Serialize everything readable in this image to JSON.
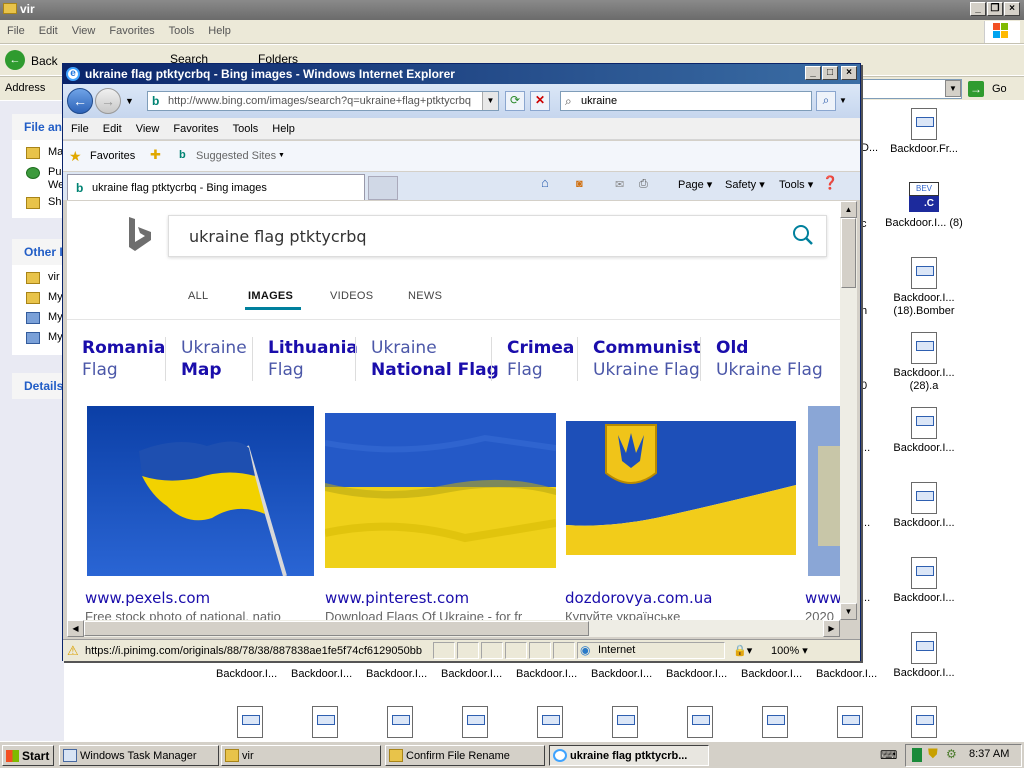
{
  "explorer": {
    "title": "vir",
    "menu": [
      "File",
      "Edit",
      "View",
      "Favorites",
      "Tools",
      "Help"
    ],
    "toolbar": {
      "back": "Back",
      "search": "Search",
      "folders": "Folders"
    },
    "address_label": "Address",
    "go_label": "Go",
    "left_pane": {
      "file_tasks": "File an",
      "file_items": [
        "Ma",
        "Pul",
        "We",
        "Sha"
      ],
      "other_places": "Other I",
      "other_items": [
        "vir",
        "My",
        "My",
        "My"
      ],
      "details": "Details"
    },
    "clipped_col": [
      "D...",
      "c",
      "h",
      "0",
      "...",
      "...",
      "...",
      "...",
      "..."
    ],
    "files_right": [
      {
        "name": "Backdoor.Fr...",
        "icon": "doc"
      },
      {
        "name": "Backdoor.I... (8)",
        "icon": "c-source"
      },
      {
        "name": "Backdoor.I... (18).Bomber",
        "icon": "doc"
      },
      {
        "name": "Backdoor.I... (28).a",
        "icon": "doc"
      },
      {
        "name": "Backdoor.I...",
        "icon": "doc"
      },
      {
        "name": "Backdoor.I...",
        "icon": "doc"
      },
      {
        "name": "Backdoor.I...",
        "icon": "doc"
      },
      {
        "name": "Backdoor.I...",
        "icon": "doc"
      },
      {
        "name": "Backdoor.I...",
        "icon": "doc"
      }
    ],
    "files_bottom": [
      "Backdoor.I...",
      "Backdoor.I...",
      "Backdoor.I...",
      "Backdoor.I...",
      "Backdoor.I...",
      "Backdoor.I...",
      "Backdoor.I...",
      "Backdoor.I...",
      "Backdoor.I..."
    ],
    "cdoc_labels": {
      "top": "BEV",
      "bottom": ".C"
    }
  },
  "ie": {
    "title": "ukraine flag ptktycrbq - Bing images - Windows Internet Explorer",
    "url": "http://www.bing.com/images/search?q=ukraine+flag+ptktycrbq",
    "search_value": "ukraine",
    "menu": [
      "File",
      "Edit",
      "View",
      "Favorites",
      "Tools",
      "Help"
    ],
    "favorites_label": "Favorites",
    "suggested_sites": "Suggested Sites",
    "tab_title": "ukraine flag ptktycrbq - Bing images",
    "commands": {
      "page": "Page",
      "safety": "Safety",
      "tools": "Tools"
    },
    "status_text": "https://i.pinimg.com/originals/88/78/38/887838ae1fe5f74cf6129050bb",
    "zone": "Internet",
    "zoom": "100%"
  },
  "bing": {
    "query": "ukraine flag ptktycrbq",
    "scopes": [
      "ALL",
      "IMAGES",
      "VIDEOS",
      "NEWS"
    ],
    "active_scope": "IMAGES",
    "related": [
      {
        "line1": "Romania",
        "line2": "Flag",
        "bold": 1
      },
      {
        "line1": "Ukraine",
        "line2": "Map",
        "bold": 2
      },
      {
        "line1": "Lithuania",
        "line2": "Flag",
        "bold": 1
      },
      {
        "line1": "Ukraine",
        "line2": "National Flag",
        "bold": 2
      },
      {
        "line1": "Crimea",
        "line2": "Flag",
        "bold": 1
      },
      {
        "line1": "Communist",
        "line2": "Ukraine Flag",
        "bold": 1
      },
      {
        "line1": "Old",
        "line2": "Ukraine Flag",
        "bold": 1
      }
    ],
    "results": [
      {
        "source": "www.pexels.com",
        "desc": "Free stock photo of national, natio"
      },
      {
        "source": "www.pinterest.com",
        "desc": "Download Flags Of Ukraine - for fr"
      },
      {
        "source": "dozdorovya.com.ua",
        "desc": "Купуйте українське"
      },
      {
        "source": "www",
        "desc": "2020"
      }
    ],
    "colors": {
      "flag_blue": "#1d5fbf",
      "flag_yellow": "#f2d200",
      "link": "#1a0dab",
      "accent": "#00809d"
    }
  },
  "taskbar": {
    "start": "Start",
    "tasks": [
      "Windows Task Manager",
      "vir",
      "Confirm File Rename",
      "ukraine flag ptktycrb..."
    ],
    "clock": "8:37 AM"
  }
}
